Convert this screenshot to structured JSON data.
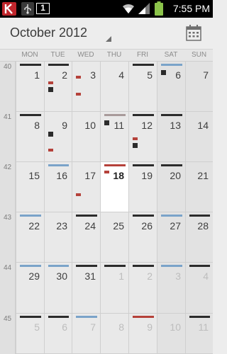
{
  "status_bar": {
    "time": "7:55 PM",
    "notification_count": "1",
    "icons": [
      "app-logo-icon",
      "usb-icon",
      "wifi-icon",
      "signal-icon",
      "battery-icon"
    ]
  },
  "header": {
    "month_title": "October 2012",
    "today_icon": "calendar-today-icon"
  },
  "weekdays": [
    "MON",
    "TUE",
    "WED",
    "THU",
    "FRI",
    "SAT",
    "SUN"
  ],
  "colors": {
    "black_event": "#2b2b2b",
    "blue_event": "#7aa3c9",
    "red_event": "#b5413a",
    "grey_event": "#a89a9a",
    "today_bg": "#ffffff"
  },
  "weeks": [
    {
      "number": "40",
      "days": [
        {
          "label": "1",
          "events": [
            {
              "type": "bar",
              "color": "black"
            }
          ]
        },
        {
          "label": "2",
          "events": [
            {
              "type": "bar",
              "color": "black"
            },
            {
              "type": "mark",
              "color": "red",
              "row": 3
            },
            {
              "type": "mark",
              "color": "black",
              "row": 4
            }
          ]
        },
        {
          "label": "3",
          "events": [
            {
              "type": "mark",
              "color": "red",
              "row": 2
            },
            {
              "type": "mark",
              "color": "red",
              "row": 5
            }
          ]
        },
        {
          "label": "4",
          "events": []
        },
        {
          "label": "5",
          "events": [
            {
              "type": "bar",
              "color": "black"
            }
          ]
        },
        {
          "label": "6",
          "weekend": true,
          "events": [
            {
              "type": "bar",
              "color": "blue"
            },
            {
              "type": "mark",
              "color": "black",
              "row": 1
            }
          ]
        },
        {
          "label": "7",
          "weekend": true,
          "events": []
        }
      ]
    },
    {
      "number": "41",
      "days": [
        {
          "label": "8",
          "events": [
            {
              "type": "bar",
              "color": "black"
            }
          ]
        },
        {
          "label": "9",
          "events": [
            {
              "type": "mark",
              "color": "black",
              "row": 3
            },
            {
              "type": "mark",
              "color": "red",
              "row": 6
            }
          ]
        },
        {
          "label": "10",
          "events": []
        },
        {
          "label": "11",
          "events": [
            {
              "type": "bar",
              "color": "grey"
            },
            {
              "type": "mark",
              "color": "black",
              "row": 1
            }
          ]
        },
        {
          "label": "12",
          "events": [
            {
              "type": "bar",
              "color": "black"
            },
            {
              "type": "mark",
              "color": "red",
              "row": 4
            },
            {
              "type": "mark",
              "color": "black",
              "row": 5
            }
          ]
        },
        {
          "label": "13",
          "weekend": true,
          "events": [
            {
              "type": "bar",
              "color": "black"
            }
          ]
        },
        {
          "label": "14",
          "weekend": true,
          "events": []
        }
      ]
    },
    {
      "number": "42",
      "days": [
        {
          "label": "15",
          "events": []
        },
        {
          "label": "16",
          "events": [
            {
              "type": "bar",
              "color": "blue"
            }
          ]
        },
        {
          "label": "17",
          "events": [
            {
              "type": "mark",
              "color": "red",
              "row": 5
            }
          ]
        },
        {
          "label": "18",
          "today": true,
          "events": [
            {
              "type": "bar",
              "color": "red"
            },
            {
              "type": "mark",
              "color": "red",
              "row": 1
            }
          ]
        },
        {
          "label": "19",
          "events": [
            {
              "type": "bar",
              "color": "black"
            }
          ]
        },
        {
          "label": "20",
          "weekend": true,
          "events": [
            {
              "type": "bar",
              "color": "black"
            }
          ]
        },
        {
          "label": "21",
          "weekend": true,
          "events": []
        }
      ]
    },
    {
      "number": "43",
      "days": [
        {
          "label": "22",
          "events": [
            {
              "type": "bar",
              "color": "blue"
            }
          ]
        },
        {
          "label": "23",
          "events": []
        },
        {
          "label": "24",
          "events": [
            {
              "type": "bar",
              "color": "black"
            }
          ]
        },
        {
          "label": "25",
          "events": []
        },
        {
          "label": "26",
          "events": [
            {
              "type": "bar",
              "color": "black"
            }
          ]
        },
        {
          "label": "27",
          "weekend": true,
          "events": [
            {
              "type": "bar",
              "color": "blue"
            }
          ]
        },
        {
          "label": "28",
          "weekend": true,
          "events": [
            {
              "type": "bar",
              "color": "black"
            }
          ]
        }
      ]
    },
    {
      "number": "44",
      "days": [
        {
          "label": "29",
          "events": [
            {
              "type": "bar",
              "color": "blue"
            }
          ]
        },
        {
          "label": "30",
          "events": [
            {
              "type": "bar",
              "color": "blue"
            }
          ]
        },
        {
          "label": "31",
          "events": [
            {
              "type": "bar",
              "color": "black"
            }
          ]
        },
        {
          "label": "1",
          "other": true,
          "events": [
            {
              "type": "bar",
              "color": "black"
            }
          ]
        },
        {
          "label": "2",
          "other": true,
          "events": [
            {
              "type": "bar",
              "color": "black"
            }
          ]
        },
        {
          "label": "3",
          "other": true,
          "weekend": true,
          "events": [
            {
              "type": "bar",
              "color": "blue"
            }
          ]
        },
        {
          "label": "4",
          "other": true,
          "weekend": true,
          "events": [
            {
              "type": "bar",
              "color": "black"
            }
          ]
        }
      ]
    },
    {
      "number": "45",
      "days": [
        {
          "label": "5",
          "other": true,
          "events": [
            {
              "type": "bar",
              "color": "black"
            }
          ]
        },
        {
          "label": "6",
          "other": true,
          "events": [
            {
              "type": "bar",
              "color": "black"
            }
          ]
        },
        {
          "label": "7",
          "other": true,
          "events": [
            {
              "type": "bar",
              "color": "blue"
            }
          ]
        },
        {
          "label": "8",
          "other": true,
          "events": []
        },
        {
          "label": "9",
          "other": true,
          "events": [
            {
              "type": "bar",
              "color": "red"
            }
          ]
        },
        {
          "label": "10",
          "other": true,
          "weekend": true,
          "events": []
        },
        {
          "label": "11",
          "other": true,
          "weekend": true,
          "events": [
            {
              "type": "bar",
              "color": "black"
            }
          ]
        }
      ]
    }
  ]
}
